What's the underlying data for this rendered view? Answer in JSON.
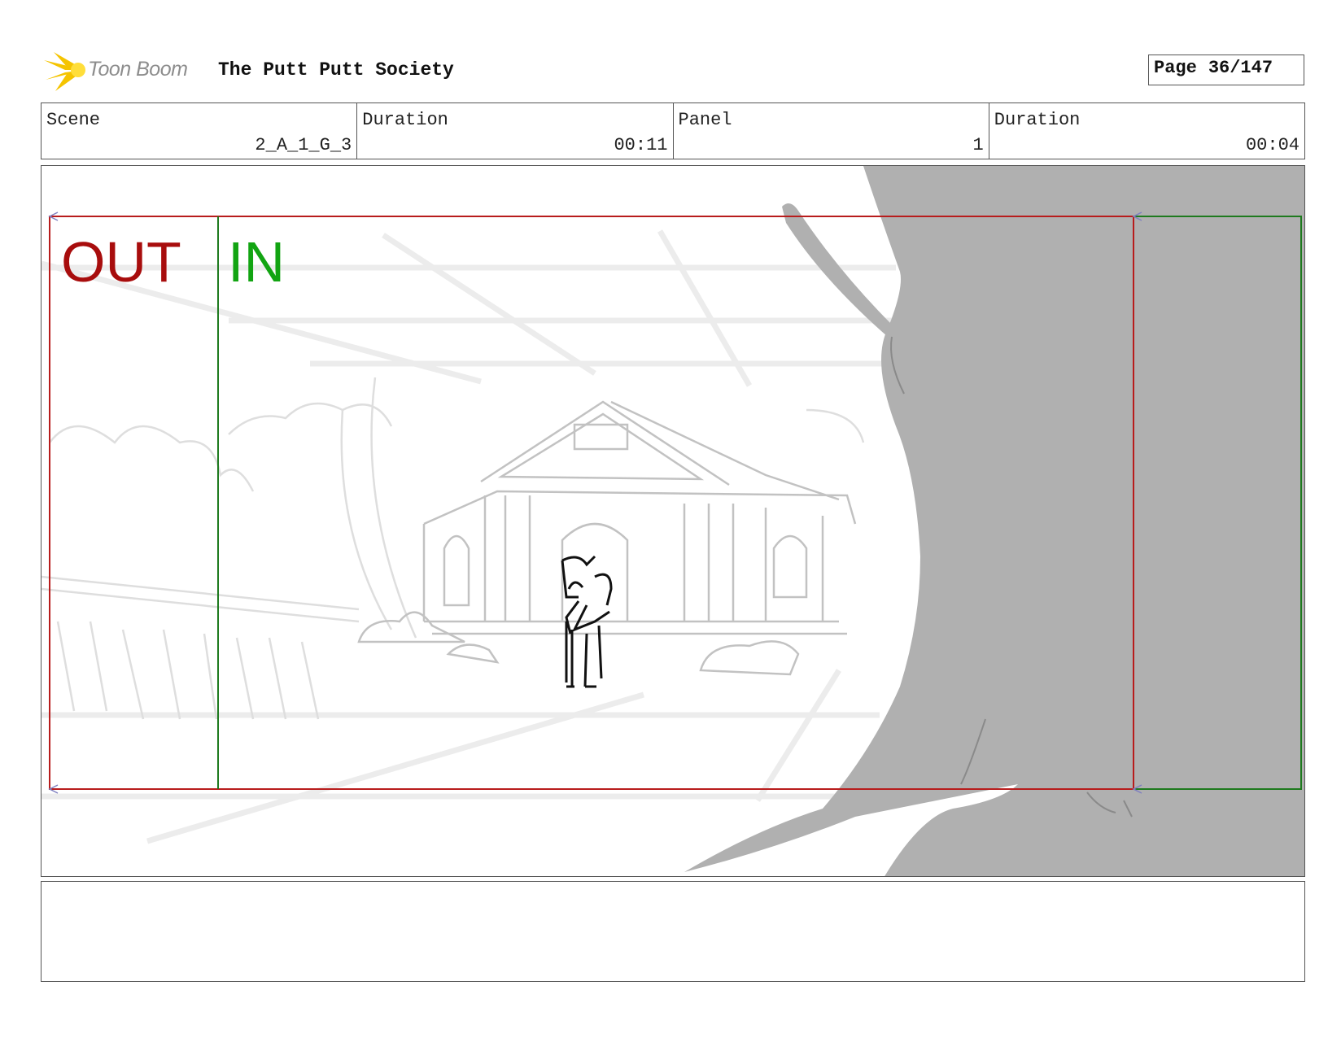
{
  "header": {
    "logo_text": "Toon Boom",
    "logo_icon": "starburst-logo-icon",
    "project_title": "The Putt Putt Society",
    "page_label": "Page",
    "page_value": "36/147"
  },
  "info": [
    {
      "label": "Scene",
      "value": "2_A_1_G_3"
    },
    {
      "label": "Duration",
      "value": "00:11"
    },
    {
      "label": "Panel",
      "value": "1"
    },
    {
      "label": "Duration",
      "value": "00:04"
    }
  ],
  "panel": {
    "out_label": "OUT",
    "in_label": "IN",
    "colors": {
      "out_frame": "#b81c1c",
      "in_frame": "#1e7a1e",
      "tree": "#b0b0b0",
      "sketch": "#c8c8c8"
    }
  },
  "notes": {
    "text": ""
  }
}
